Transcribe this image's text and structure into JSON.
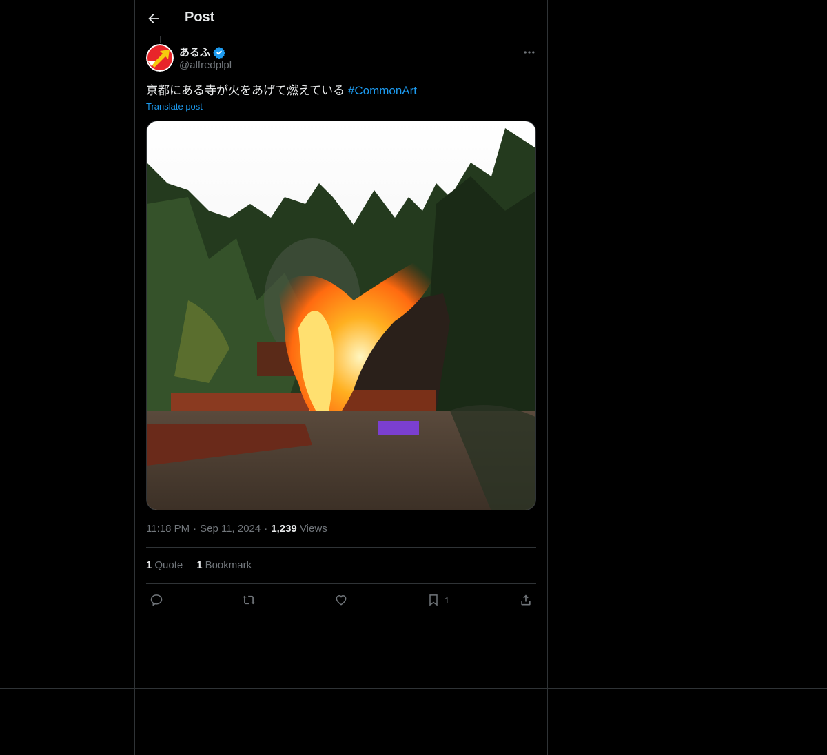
{
  "header": {
    "title": "Post"
  },
  "author": {
    "display_name": "あるふ",
    "handle": "@alfredplpl"
  },
  "post": {
    "text": "京都にある寺が火をあげて燃えている",
    "hashtag": "#CommonArt",
    "translate_label": "Translate post",
    "time": "11:18 PM",
    "date": "Sep 11, 2024",
    "views_count": "1,239",
    "views_label": "Views"
  },
  "stats": {
    "quote_count": "1",
    "quote_label": "Quote",
    "bookmark_count": "1",
    "bookmark_label": "Bookmark"
  },
  "actions": {
    "reply": "reply-icon",
    "repost": "repost-icon",
    "like": "heart-icon",
    "bookmark": "bookmark-icon",
    "bookmark_count": "1",
    "share": "share-icon"
  },
  "colors": {
    "accent": "#1d9bf0",
    "background": "#000000",
    "border": "#2f3336",
    "muted": "#71767b"
  }
}
